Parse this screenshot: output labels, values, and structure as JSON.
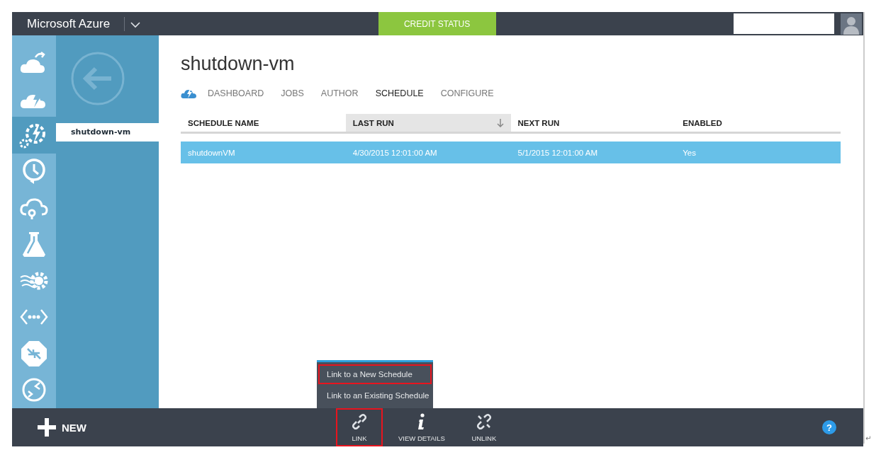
{
  "header": {
    "title": "Microsoft Azure",
    "credit_button": "CREDIT STATUS"
  },
  "nav_icons": [
    {
      "kind": "cloud-arrow",
      "selected": false
    },
    {
      "kind": "cloud-bolt",
      "selected": false
    },
    {
      "kind": "gear-bolt",
      "selected": true
    },
    {
      "kind": "clock-cycle",
      "selected": false
    },
    {
      "kind": "cloud-pin",
      "selected": false
    },
    {
      "kind": "flask",
      "selected": false
    },
    {
      "kind": "gear-waves",
      "selected": false
    },
    {
      "kind": "code-dots",
      "selected": false
    },
    {
      "kind": "arrows-octagon",
      "selected": false
    },
    {
      "kind": "circle-arrows",
      "selected": false
    }
  ],
  "panel": {
    "items": [
      {
        "label": "shutdown-vm",
        "selected": true
      }
    ]
  },
  "page": {
    "title": "shutdown-vm",
    "tabs": [
      {
        "label": "DASHBOARD",
        "selected": false
      },
      {
        "label": "JOBS",
        "selected": false
      },
      {
        "label": "AUTHOR",
        "selected": false
      },
      {
        "label": "SCHEDULE",
        "selected": true
      },
      {
        "label": "CONFIGURE",
        "selected": false
      }
    ]
  },
  "table": {
    "columns": [
      {
        "label": "SCHEDULE NAME",
        "sorted": false
      },
      {
        "label": "LAST RUN",
        "sorted": true
      },
      {
        "label": "NEXT RUN",
        "sorted": false
      },
      {
        "label": "ENABLED",
        "sorted": false
      }
    ],
    "rows": [
      {
        "cells": [
          "shutdownVM",
          "4/30/2015 12:01:00 AM",
          "5/1/2015 12:01:00 AM",
          "Yes"
        ],
        "selected": true
      }
    ]
  },
  "popup_menu": {
    "items": [
      {
        "label": "Link to a New Schedule",
        "highlighted": true
      },
      {
        "label": "Link to an Existing Schedule",
        "highlighted": false
      }
    ]
  },
  "command_bar": {
    "new_button": "NEW",
    "actions": [
      {
        "kind": "link",
        "label": "LINK",
        "highlighted": true
      },
      {
        "kind": "info",
        "label": "VIEW DETAILS",
        "highlighted": false
      },
      {
        "kind": "unlink",
        "label": "UNLINK",
        "highlighted": false
      }
    ],
    "help_button": "?"
  },
  "trailing_mark": "↵"
}
